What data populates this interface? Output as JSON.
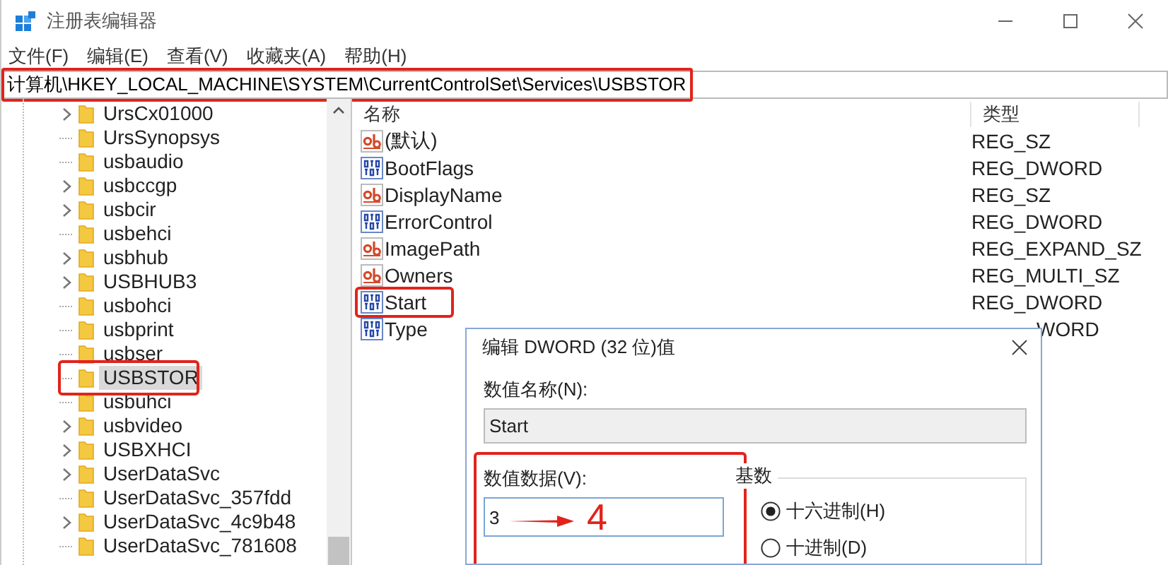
{
  "window": {
    "title": "注册表编辑器"
  },
  "menu": [
    "文件(F)",
    "编辑(E)",
    "查看(V)",
    "收藏夹(A)",
    "帮助(H)"
  ],
  "address": {
    "value": "计算机\\HKEY_LOCAL_MACHINE\\SYSTEM\\CurrentControlSet\\Services\\USBSTOR",
    "highlighted": true
  },
  "tree": {
    "items": [
      {
        "label": "UrsCx01000",
        "expandable": true,
        "selected": false,
        "highlighted": false
      },
      {
        "label": "UrsSynopsys",
        "expandable": false,
        "selected": false,
        "highlighted": false
      },
      {
        "label": "usbaudio",
        "expandable": false,
        "selected": false,
        "highlighted": false
      },
      {
        "label": "usbccgp",
        "expandable": true,
        "selected": false,
        "highlighted": false
      },
      {
        "label": "usbcir",
        "expandable": true,
        "selected": false,
        "highlighted": false
      },
      {
        "label": "usbehci",
        "expandable": false,
        "selected": false,
        "highlighted": false
      },
      {
        "label": "usbhub",
        "expandable": true,
        "selected": false,
        "highlighted": false
      },
      {
        "label": "USBHUB3",
        "expandable": true,
        "selected": false,
        "highlighted": false
      },
      {
        "label": "usbohci",
        "expandable": false,
        "selected": false,
        "highlighted": false
      },
      {
        "label": "usbprint",
        "expandable": false,
        "selected": false,
        "highlighted": false
      },
      {
        "label": "usbser",
        "expandable": false,
        "selected": false,
        "highlighted": false
      },
      {
        "label": "USBSTOR",
        "expandable": false,
        "selected": true,
        "highlighted": true
      },
      {
        "label": "usbuhci",
        "expandable": false,
        "selected": false,
        "highlighted": false
      },
      {
        "label": "usbvideo",
        "expandable": true,
        "selected": false,
        "highlighted": false
      },
      {
        "label": "USBXHCI",
        "expandable": true,
        "selected": false,
        "highlighted": false
      },
      {
        "label": "UserDataSvc",
        "expandable": true,
        "selected": false,
        "highlighted": false
      },
      {
        "label": "UserDataSvc_357fdd",
        "expandable": false,
        "selected": false,
        "highlighted": false
      },
      {
        "label": "UserDataSvc_4c9b48",
        "expandable": true,
        "selected": false,
        "highlighted": false
      },
      {
        "label": "UserDataSvc_781608",
        "expandable": false,
        "selected": false,
        "highlighted": false
      }
    ]
  },
  "values": {
    "columns": [
      "名称",
      "类型"
    ],
    "rows": [
      {
        "name": "(默认)",
        "kind": "string",
        "type": "REG_SZ",
        "highlighted": false,
        "covered": false
      },
      {
        "name": "BootFlags",
        "kind": "binary",
        "type": "REG_DWORD",
        "highlighted": false,
        "covered": false
      },
      {
        "name": "DisplayName",
        "kind": "string",
        "type": "REG_SZ",
        "highlighted": false,
        "covered": false
      },
      {
        "name": "ErrorControl",
        "kind": "binary",
        "type": "REG_DWORD",
        "highlighted": false,
        "covered": false
      },
      {
        "name": "ImagePath",
        "kind": "string",
        "type": "REG_EXPAND_SZ",
        "highlighted": false,
        "covered": false
      },
      {
        "name": "Owners",
        "kind": "string",
        "type": "REG_MULTI_SZ",
        "highlighted": false,
        "covered": false
      },
      {
        "name": "Start",
        "kind": "binary",
        "type": "REG_DWORD",
        "highlighted": true,
        "covered": false
      },
      {
        "name": "Type",
        "kind": "binary",
        "type": "WORD",
        "highlighted": false,
        "covered": true
      }
    ]
  },
  "dialog": {
    "title": "编辑 DWORD (32 位)值",
    "name_label": "数值名称(N):",
    "name_value": "Start",
    "data_label": "数值数据(V):",
    "data_value": "3",
    "data_highlighted": true,
    "base_label": "基数",
    "bases": [
      {
        "label": "十六进制(H)",
        "selected": true
      },
      {
        "label": "十进制(D)",
        "selected": false
      }
    ],
    "annotation": "4"
  }
}
